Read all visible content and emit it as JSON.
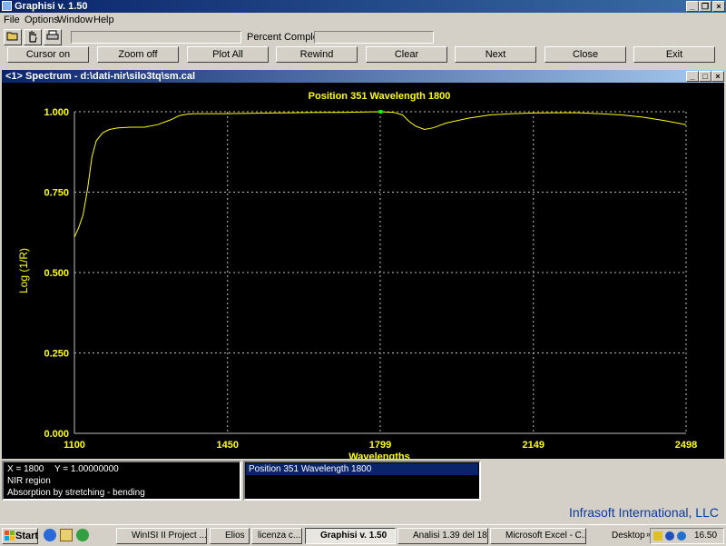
{
  "app": {
    "title": "Graphisi v. 1.50"
  },
  "menu": [
    "File",
    "Options",
    "Window",
    "Help"
  ],
  "toolbar": {
    "percent_label": "Percent Complete:"
  },
  "buttons": [
    "Cursor on",
    "Zoom off",
    "Plot All",
    "Rewind",
    "Clear",
    "Next",
    "Close",
    "Exit"
  ],
  "child": {
    "title": "<1> Spectrum - d:\\dati-nir\\silo3tq\\sm.cal"
  },
  "colors": {
    "plot_bg": "#000000",
    "trace": "#ffff00",
    "grid": "#c0c0c0",
    "cursor_marker": "#00ff00"
  },
  "chart_data": {
    "type": "line",
    "title": "Position 351   Wavelength 1800",
    "xlabel": "Wavelengths",
    "ylabel": "Log (1/R)",
    "xlim": [
      1100,
      2498
    ],
    "ylim": [
      0,
      1
    ],
    "xticks": [
      "1100",
      "1450",
      "1799",
      "2149",
      "2498"
    ],
    "yticks": [
      "0.000",
      "0.250",
      "0.500",
      "0.750",
      "1.000"
    ],
    "grid": true,
    "cursor": {
      "x": 1800,
      "y": 1.0
    },
    "series": [
      {
        "x": [
          1100,
          1110,
          1120,
          1130,
          1140,
          1150,
          1165,
          1180,
          1200,
          1230,
          1260,
          1290,
          1320,
          1340,
          1360,
          1380,
          1400,
          1450,
          1500,
          1550,
          1600,
          1650,
          1700,
          1750,
          1800,
          1830,
          1850,
          1865,
          1880,
          1900,
          1920,
          1950,
          2000,
          2050,
          2100,
          2150,
          2200,
          2250,
          2300,
          2350,
          2400,
          2450,
          2498
        ],
        "y": [
          0.61,
          0.64,
          0.68,
          0.76,
          0.86,
          0.91,
          0.935,
          0.945,
          0.95,
          0.952,
          0.952,
          0.96,
          0.975,
          0.988,
          0.993,
          0.994,
          0.994,
          0.994,
          0.995,
          0.996,
          0.997,
          0.998,
          0.998,
          0.999,
          1.0,
          0.998,
          0.99,
          0.97,
          0.955,
          0.945,
          0.95,
          0.965,
          0.98,
          0.99,
          0.994,
          0.996,
          0.997,
          0.997,
          0.994,
          0.99,
          0.983,
          0.972,
          0.96
        ]
      }
    ]
  },
  "info": {
    "x_label": "X = 1800",
    "y_label": "Y = 1.00000000",
    "line2": "NIR region",
    "line3": "Absorption by stretching - bending",
    "list_item": "Position 351   Wavelength 1800"
  },
  "status": {
    "company": "Infrasoft International, LLC"
  },
  "taskbar": {
    "start": "Start",
    "items": [
      "WinISI II Project ...",
      "Elios",
      "licenza c...",
      "Graphisi v. 1.50",
      "Analisi  1.39 del 18...",
      "Microsoft Excel - C...",
      "Desktop"
    ],
    "clock": "16.50"
  }
}
